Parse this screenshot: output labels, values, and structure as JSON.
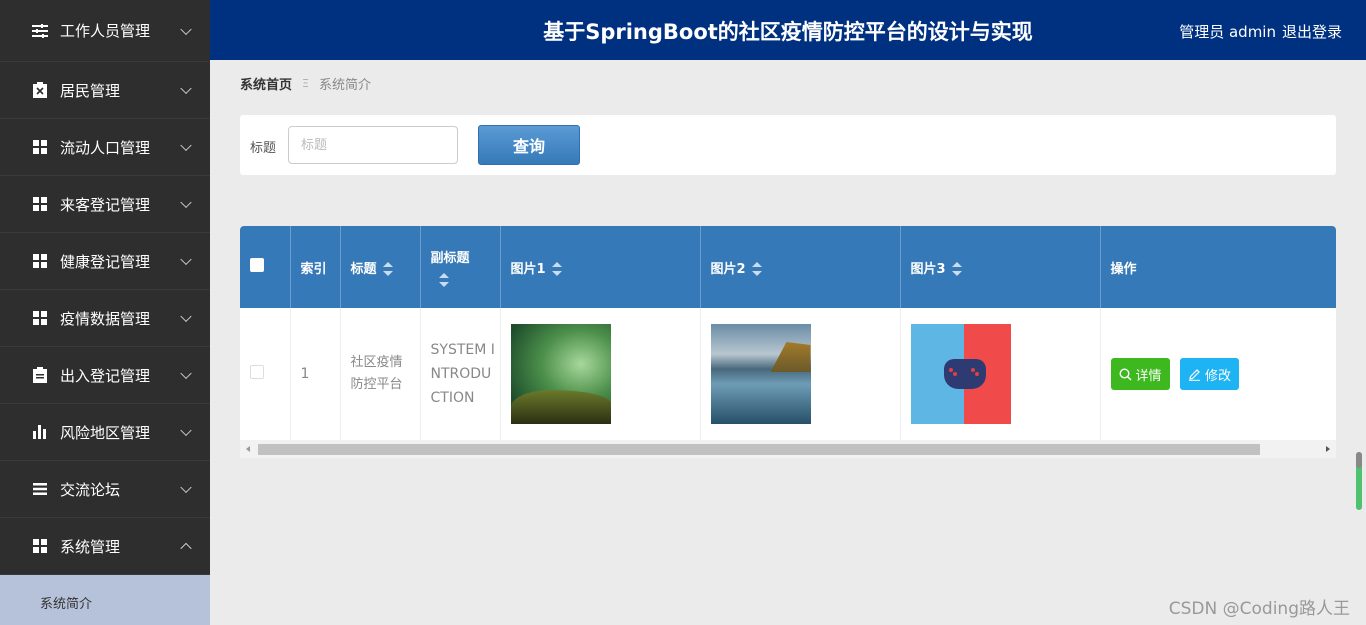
{
  "sidebar": {
    "items": [
      {
        "label": "工作人员管理",
        "icon": "sliders-icon"
      },
      {
        "label": "居民管理",
        "icon": "clipboard-x-icon"
      },
      {
        "label": "流动人口管理",
        "icon": "grid-icon"
      },
      {
        "label": "来客登记管理",
        "icon": "grid-icon"
      },
      {
        "label": "健康登记管理",
        "icon": "grid-icon"
      },
      {
        "label": "疫情数据管理",
        "icon": "grid-icon"
      },
      {
        "label": "出入登记管理",
        "icon": "clipboard-icon"
      },
      {
        "label": "风险地区管理",
        "icon": "bar-chart-icon"
      },
      {
        "label": "交流论坛",
        "icon": "list-icon"
      },
      {
        "label": "系统管理",
        "icon": "grid-icon"
      }
    ],
    "submenu": {
      "label": "系统简介"
    }
  },
  "header": {
    "title": "基于SpringBoot的社区疫情防控平台的设计与实现",
    "user": "管理员 admin",
    "logout": "退出登录"
  },
  "breadcrumb": {
    "home": "系统首页",
    "sep": "Ξ",
    "current": "系统简介"
  },
  "search": {
    "label": "标题",
    "placeholder": "标题",
    "button": "查询"
  },
  "table": {
    "headers": {
      "index": "索引",
      "title": "标题",
      "subtitle": "副标题",
      "pic1": "图片1",
      "pic2": "图片2",
      "pic3": "图片3",
      "actions": "操作"
    },
    "rows": [
      {
        "index": "1",
        "title": "社区疫情防控平台",
        "subtitle": "SYSTEM INTRODUCTION",
        "detail_label": "详情",
        "edit_label": "修改"
      }
    ]
  },
  "colors": {
    "header": "#003080",
    "sidebar": "#2f2f2f",
    "table_head": "#3579b8",
    "detail": "#3eb81f",
    "edit": "#1eb3f2"
  },
  "watermark": "CSDN @Coding路人王"
}
